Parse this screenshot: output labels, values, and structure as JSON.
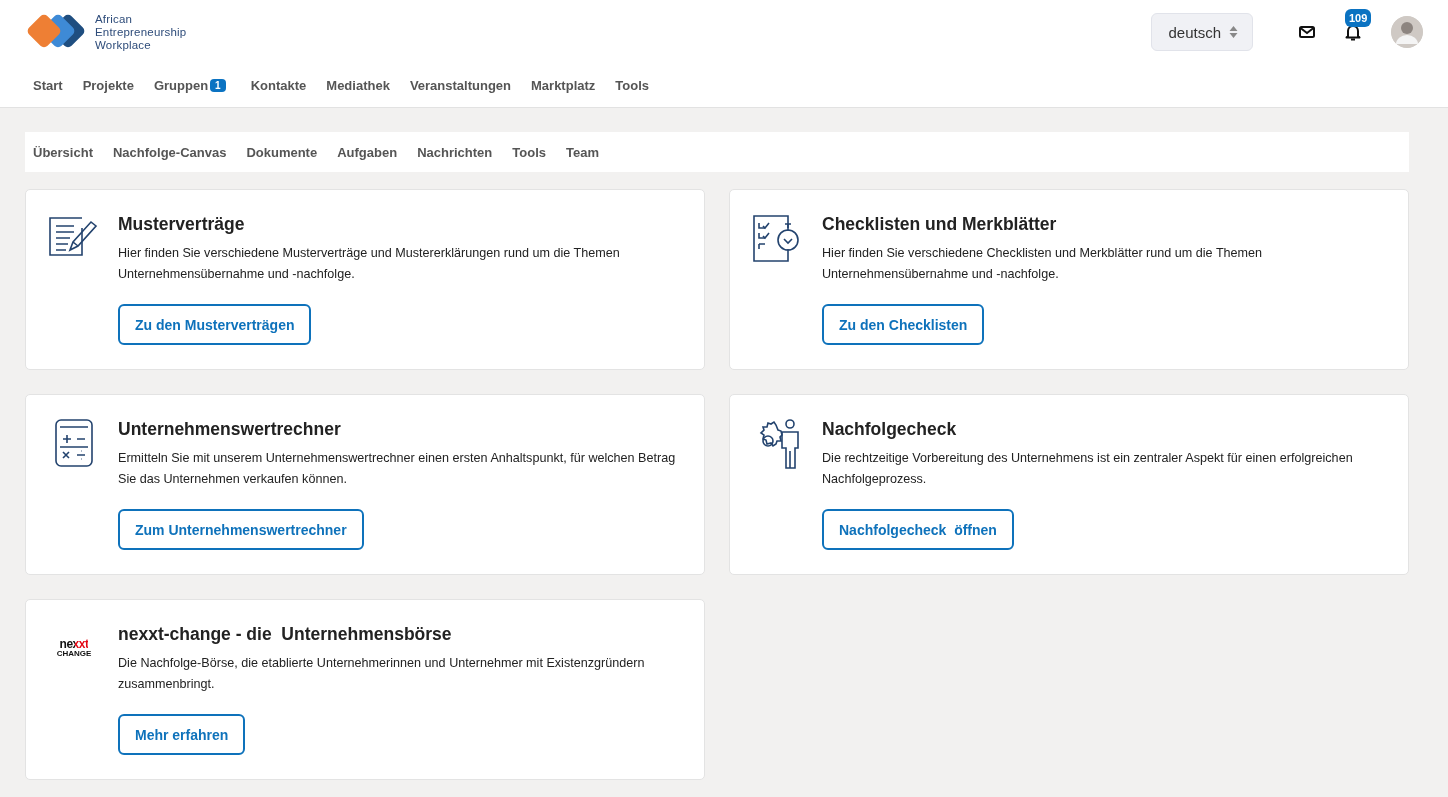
{
  "header": {
    "logo_text": [
      "African",
      "Entrepreneurship",
      "Workplace"
    ],
    "language": "deutsch",
    "notification_count": "109"
  },
  "main_nav": [
    {
      "label": "Start"
    },
    {
      "label": "Projekte"
    },
    {
      "label": "Gruppen",
      "badge": "1"
    },
    {
      "label": "Kontakte"
    },
    {
      "label": "Mediathek"
    },
    {
      "label": "Veranstaltungen"
    },
    {
      "label": "Marktplatz"
    },
    {
      "label": "Tools"
    }
  ],
  "sub_nav": [
    "Übersicht",
    "Nachfolge-Canvas",
    "Dokumente",
    "Aufgaben",
    "Nachrichten",
    "Tools",
    "Team"
  ],
  "cards": [
    {
      "kind": "contract",
      "title": "Musterverträge",
      "text": "Hier finden Sie verschiedene Musterverträge und Mustererklärungen rund um die Themen Unternehmensübernahme und -nachfolge.",
      "button": "Zu den Musterverträgen"
    },
    {
      "kind": "checklist",
      "title": "Checklisten und Merkblätter",
      "text": "Hier finden Sie verschiedene Checklisten und Merkblätter rund um die Themen Unternehmensübernahme und -nachfolge.",
      "button": "Zu den Checklisten"
    },
    {
      "kind": "calculator",
      "title": "Unternehmenswertrechner",
      "text": "Ermitteln Sie mit unserem Unternehmenswertrechner einen ersten Anhaltspunkt, für welchen Betrag Sie das Unternehmen verkaufen können.",
      "button": "Zum Unternehmenswertrechner"
    },
    {
      "kind": "person-gear",
      "title": "Nachfolgecheck",
      "text": "Die rechtzeitige Vorbereitung des Unternehmens ist ein zentraler Aspekt für einen erfolgreichen Nachfolgeprozess.",
      "button": "Nachfolgecheck  öffnen"
    },
    {
      "kind": "logo",
      "logo_text": [
        "nexxt",
        "CHANGE"
      ],
      "title": "nexxt-change - die  Unternehmensbörse",
      "text": "Die Nachfolge-Börse, die etablierte Unternehmerinnen und Unternehmer mit Existenzgründern zusammenbringt.",
      "button": "Mehr erfahren"
    }
  ]
}
